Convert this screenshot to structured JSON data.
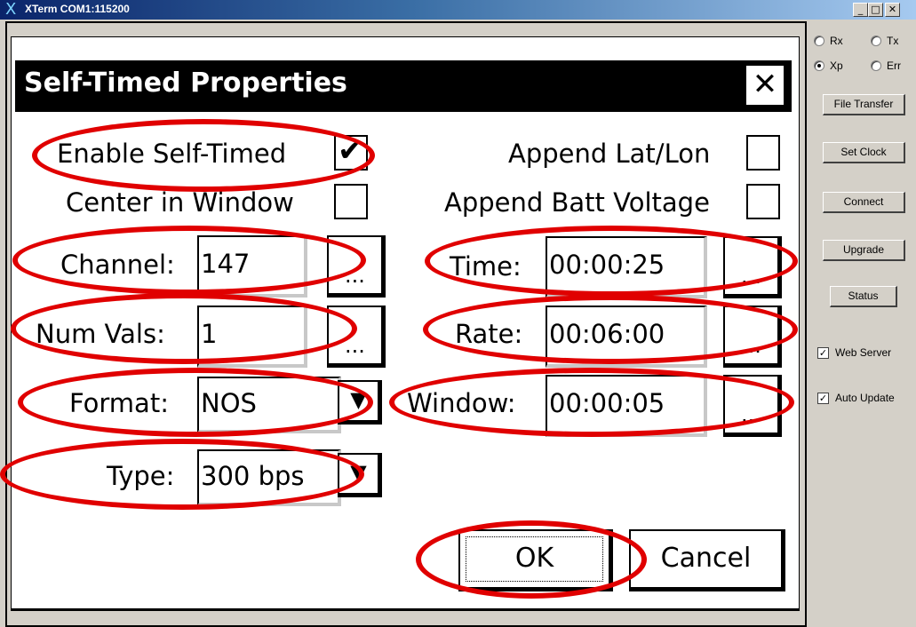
{
  "window": {
    "title": "XTerm COM1:115200",
    "icon": "x-logo-icon",
    "controls": [
      "_",
      "□",
      "✕"
    ]
  },
  "dialog": {
    "title": "Self-Timed Properties",
    "close_label": "✕",
    "enable_self_timed": {
      "label": "Enable Self-Timed",
      "checked": true,
      "mark": "✔"
    },
    "center_in_window": {
      "label": "Center in Window",
      "checked": false
    },
    "append_lat_lon": {
      "label": "Append Lat/Lon",
      "checked": false
    },
    "append_batt_voltage": {
      "label": "Append Batt Voltage",
      "checked": false
    },
    "channel": {
      "label": "Channel:",
      "value": "147",
      "browse": "..."
    },
    "num_vals": {
      "label": "Num Vals:",
      "value": "1",
      "browse": "..."
    },
    "format": {
      "label": "Format:",
      "value": "NOS",
      "arrow": "▼"
    },
    "type": {
      "label": "Type:",
      "value": "300 bps",
      "arrow": "▼"
    },
    "time": {
      "label": "Time:",
      "value": "00:00:25",
      "browse": "..."
    },
    "rate": {
      "label": "Rate:",
      "value": "00:06:00",
      "browse": "..."
    },
    "window_field": {
      "label": "Window:",
      "value": "00:00:05",
      "browse": "..."
    },
    "ok_label": "OK",
    "cancel_label": "Cancel"
  },
  "side_panel": {
    "radios": [
      {
        "label": "Rx",
        "selected": false
      },
      {
        "label": "Tx",
        "selected": false
      },
      {
        "label": "Xp",
        "selected": true
      },
      {
        "label": "Err",
        "selected": false
      }
    ],
    "buttons": [
      "File Transfer",
      "Set Clock",
      "Connect",
      "Upgrade",
      "Status"
    ],
    "web_server": {
      "label": "Web Server",
      "checked": true
    },
    "auto_update": {
      "label": "Auto Update",
      "checked": true
    },
    "check_mark": "✓"
  },
  "colors": {
    "annotation": "#e00000",
    "titlebar_start": "#0a246a",
    "titlebar_end": "#a6caf0",
    "panel_bg": "#d4d0c8"
  }
}
